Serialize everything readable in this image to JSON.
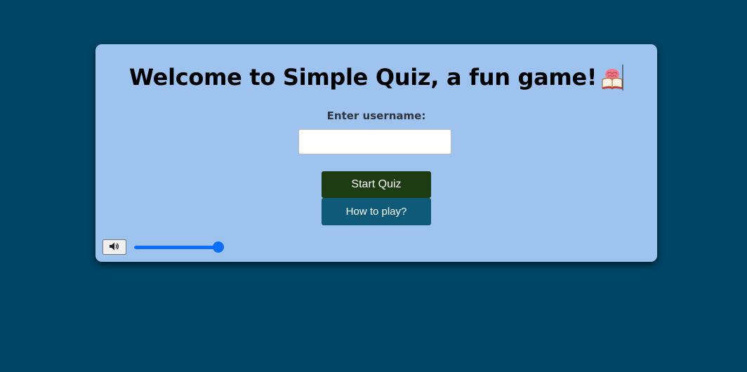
{
  "quiz": {
    "title": "Welcome to Simple Quiz, a fun game!",
    "title_icon": "book-brain-icon",
    "username_label": "Enter username:",
    "username_value": "",
    "username_placeholder": "",
    "start_button": "Start Quiz",
    "how_to_play_button": "How to play?"
  },
  "audio": {
    "sound_icon": "speaker-icon",
    "volume_level": 1.0
  },
  "colors": {
    "page_background": "#004466",
    "card_background": "#9ec3ee",
    "start_button": "#1e3c14",
    "how_to_play_button": "#0e5a78",
    "slider_accent": "#0d6efd"
  }
}
